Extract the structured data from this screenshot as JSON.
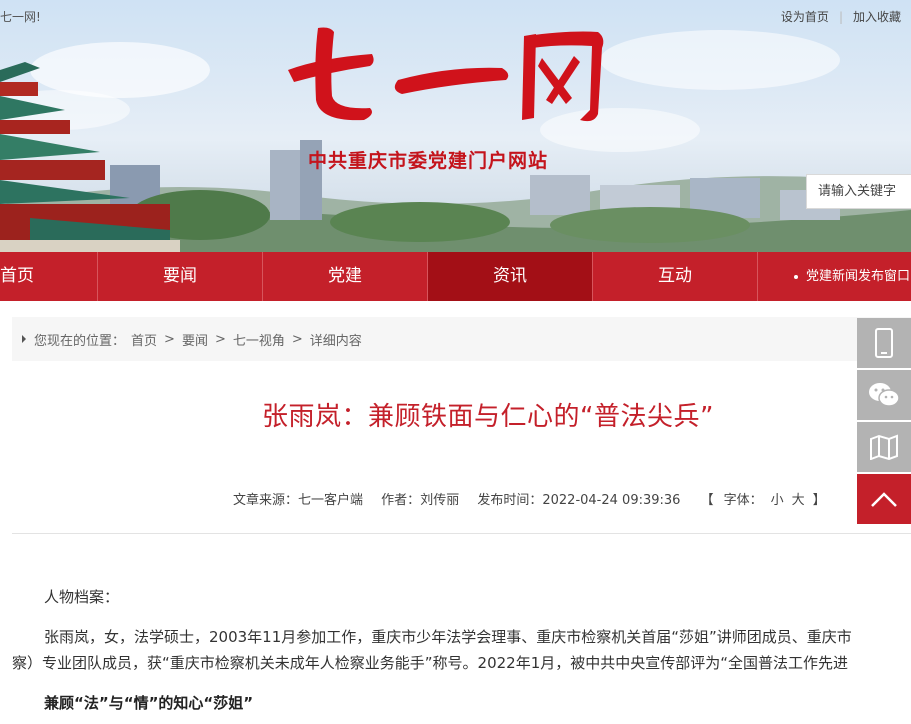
{
  "header": {
    "welcome": "七一网!",
    "links": [
      "设为首页",
      "加入收藏"
    ],
    "logo_text": "七一网",
    "subtitle": "中共重庆市委党建门户网站",
    "search_placeholder": "请输入关键字"
  },
  "nav": {
    "items": [
      {
        "label": "首页",
        "active": false
      },
      {
        "label": "要闻",
        "active": false
      },
      {
        "label": "党建",
        "active": false
      },
      {
        "label": "资讯",
        "active": true
      },
      {
        "label": "互动",
        "active": false
      }
    ],
    "news_ticker": "党建新闻发布窗口"
  },
  "breadcrumb": {
    "prefix": "您现在的位置：",
    "items": [
      "首页",
      "要闻",
      "七一视角",
      "详细内容"
    ],
    "separator": ">"
  },
  "article": {
    "title": "张雨岚：兼顾铁面与仁心的“普法尖兵”",
    "source_label": "文章来源：",
    "source": "七一客户端",
    "author_label": "作者：",
    "author": "刘传丽",
    "time_label": "发布时间：",
    "time": "2022-04-24 09:39:36",
    "font_label": "字体：",
    "font_small": "小",
    "font_large": "大",
    "bracket_open": "【",
    "bracket_close": "】",
    "paragraphs": [
      "人物档案：",
      "张雨岚，女，法学硕士，2003年11月参加工作，重庆市少年法学会理事、重庆市检察机关首届“莎姐”讲师团成员、重庆市",
      "察）专业团队成员，获“重庆市检察机关未成年人检察业务能手”称号。2022年1月，被中共中央宣传部评为“全国普法工作先进",
      "兼顾“法”与“情”的知心“莎姐”"
    ]
  },
  "side_tools": {
    "icons": [
      "mobile-icon",
      "wechat-icon",
      "map-icon",
      "back-to-top-icon"
    ]
  },
  "colors": {
    "brand_red": "#c4202a",
    "nav_active": "#a30f16",
    "side_gray": "#b3b3b3"
  }
}
